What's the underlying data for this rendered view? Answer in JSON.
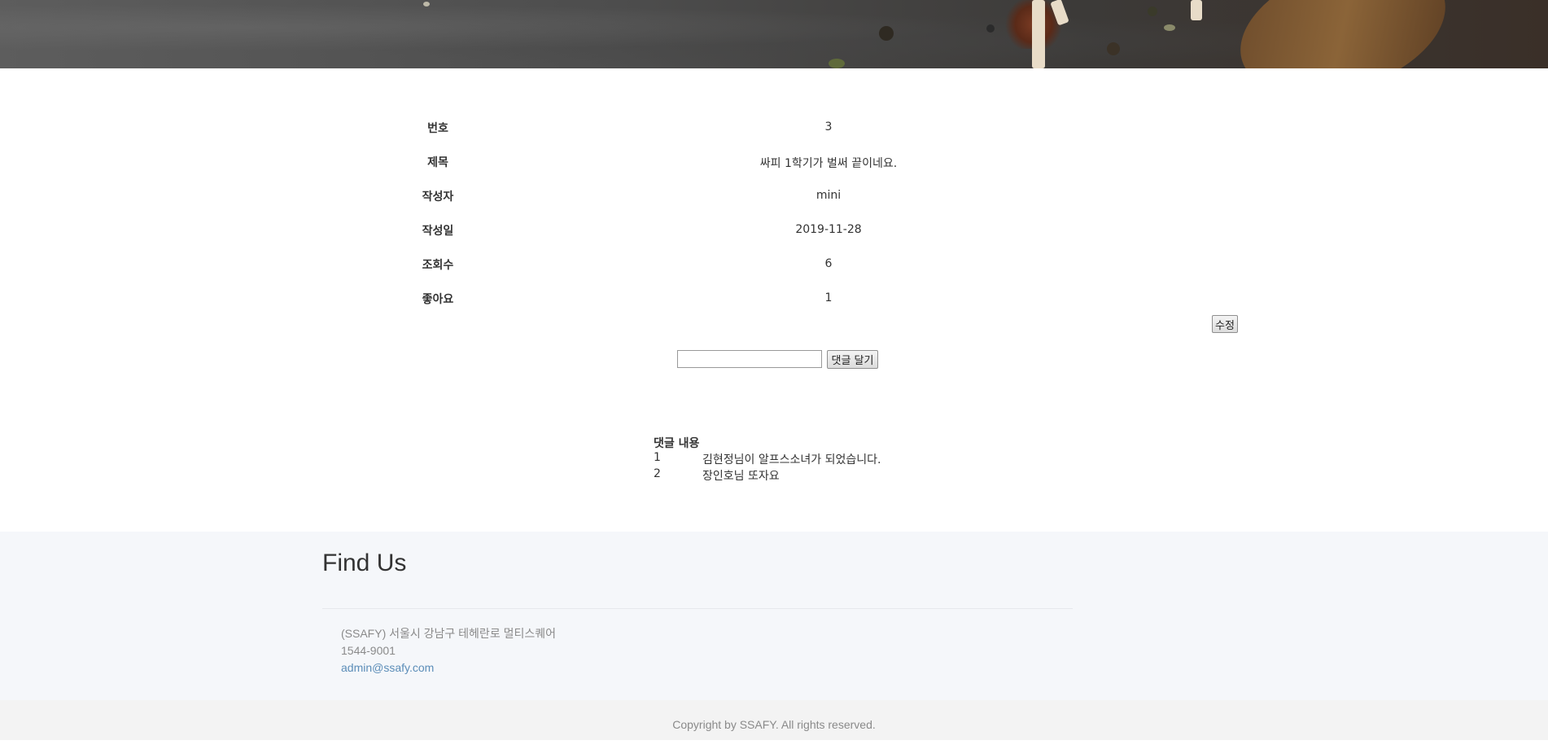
{
  "detail": {
    "rows": [
      {
        "label": "번호",
        "value": "3"
      },
      {
        "label": "제목",
        "value": "싸피 1학기가 벌써 끝이네요."
      },
      {
        "label": "작성자",
        "value": "mini"
      },
      {
        "label": "작성일",
        "value": "2019-11-28"
      },
      {
        "label": "조회수",
        "value": "6"
      },
      {
        "label": "좋아요",
        "value": "1"
      }
    ],
    "edit_label": "수정"
  },
  "comment_form": {
    "input_value": "",
    "submit_label": "댓글 달기"
  },
  "comments": {
    "header": "댓글 내용",
    "items": [
      {
        "num": "1",
        "text": "김현정님이 알프스소녀가 되었습니다."
      },
      {
        "num": "2",
        "text": "장인호님 또자요"
      }
    ]
  },
  "footer": {
    "title": "Find Us",
    "address": "(SSAFY) 서울시 강남구 테헤란로 멀티스퀘어",
    "phone": "1544-9001",
    "email": "admin@ssafy.com",
    "copyright": "Copyright by SSAFY. All rights reserved."
  },
  "colors": {
    "link": "#5b8db8",
    "footer_bg": "#f5f7fa",
    "copyright_bg": "#f3f3f3"
  }
}
